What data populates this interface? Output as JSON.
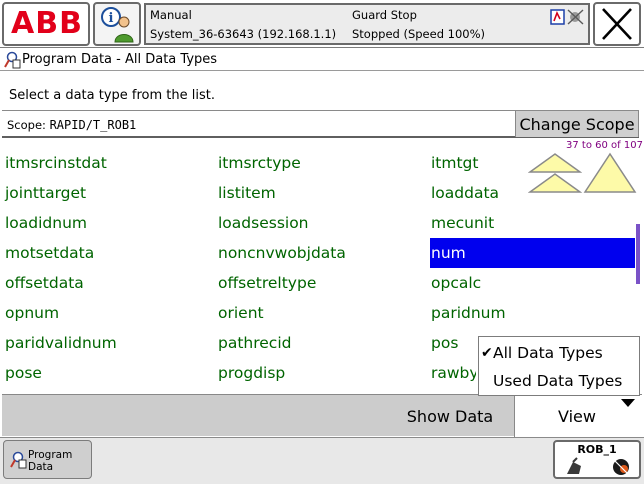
{
  "brand": {
    "letters": [
      "A",
      "B",
      "B"
    ],
    "color": "#e2001a"
  },
  "status": {
    "mode": "Manual",
    "system": "System_36-63643 (192.168.1.1)",
    "guard": "Guard Stop",
    "state": "Stopped (Speed 100%)"
  },
  "window": {
    "title": "Program Data - All Data Types",
    "instruction": "Select a data type from the list."
  },
  "scope": {
    "label": "Scope: ",
    "value": "RAPID/T_ROB1",
    "change_button": "Change Scope"
  },
  "list": {
    "page_indicator": "37 to 60 of 107",
    "columns": [
      [
        "itmsrcinstdat",
        "jointtarget",
        "loadidnum",
        "motsetdata",
        "offsetdata",
        "opnum",
        "paridvalidnum",
        "pose"
      ],
      [
        "itmsrctype",
        "listitem",
        "loadsession",
        "noncnvwobjdata",
        "offsetreltype",
        "orient",
        "pathrecid",
        "progdisp"
      ],
      [
        "itmtgt",
        "loaddata",
        "mecunit",
        "num",
        "opcalc",
        "paridnum",
        "pos",
        "rawbytes"
      ]
    ],
    "selected": "num",
    "text_color": "#006400",
    "selected_color": "#0000ee"
  },
  "view_menu": {
    "items": [
      {
        "label": "All Data Types",
        "checked": true
      },
      {
        "label": "Used Data Types",
        "checked": false
      }
    ],
    "check_glyph": "✔"
  },
  "commands": {
    "show_data": "Show Data",
    "view": "View"
  },
  "taskbar": {
    "program_data": "Program Data",
    "rob": "ROB_1"
  },
  "icons": {
    "info": "info-person-icon",
    "close": "close-icon",
    "page_up": "double-up-arrow-icon",
    "scroll_up": "up-arrow-icon"
  }
}
